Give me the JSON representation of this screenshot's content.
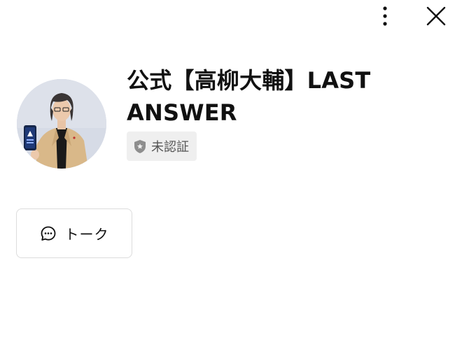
{
  "header": {
    "more_icon": "more-vertical-icon",
    "close_icon": "close-icon"
  },
  "profile": {
    "name": "公式【高柳大輔】LAST ANSWER",
    "avatar_alt": "profile photo",
    "badge_label": "未認証",
    "badge_icon": "shield-icon"
  },
  "actions": {
    "talk_label": "トーク",
    "talk_icon": "chat-bubble-icon"
  },
  "colors": {
    "background": "#ffffff",
    "text": "#111111",
    "badge_bg": "#efefef",
    "badge_text": "#555555",
    "button_border": "#dcdcdc"
  }
}
